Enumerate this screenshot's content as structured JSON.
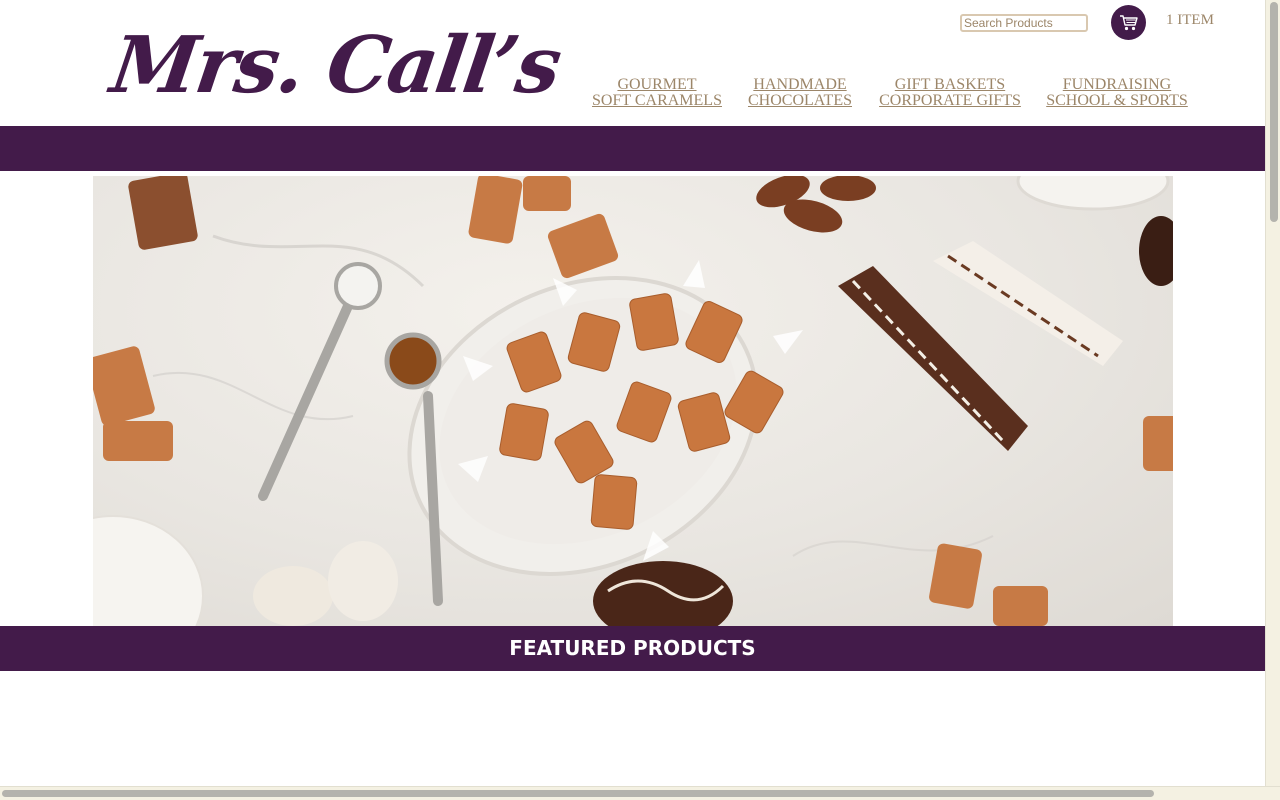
{
  "header": {
    "logo_text": "Mrs. Call’s",
    "search": {
      "placeholder": "Search Products",
      "value": ""
    },
    "cart": {
      "count_label": "1 ITEM",
      "icon": "shopping-cart-icon"
    }
  },
  "nav": [
    {
      "line1": "GOURMET ",
      "line2": "SOFT CARAMELS"
    },
    {
      "line1": " HANDMADE ",
      "line2": "CHOCOLATES"
    },
    {
      "line1": "GIFT BASKETS ",
      "line2": "CORPORATE GIFTS"
    },
    {
      "line1": "FUNDRAISING ",
      "line2": "SCHOOL & SPORTS"
    }
  ],
  "hero": {
    "image_subject": "caramels-and-chocolates-photo"
  },
  "featured": {
    "heading": "FEATURED PRODUCTS"
  },
  "colors": {
    "brand_purple": "#431b4a",
    "nav_tan": "#9c8669"
  }
}
